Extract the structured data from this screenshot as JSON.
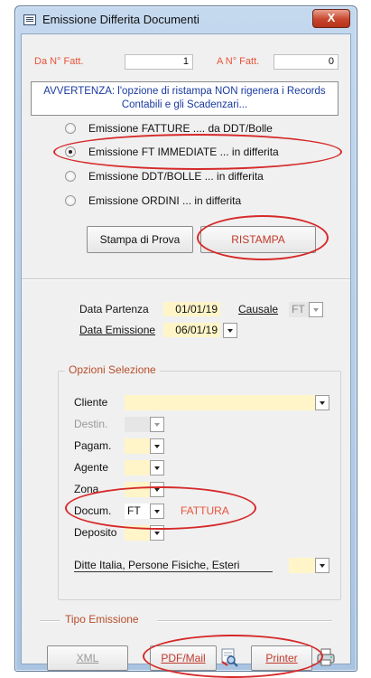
{
  "window": {
    "title": "Emissione Differita Documenti",
    "close_label": "X"
  },
  "top": {
    "from_label": "Da N° Fatt.",
    "from_value": "1",
    "to_label": "A N° Fatt.",
    "to_value": "0",
    "warning": "AVVERTENZA: l'opzione di ristampa NON rigenera i Records Contabili e gli Scadenzari..."
  },
  "options": [
    {
      "label": "Emissione FATTURE ....  da DDT/Bolle",
      "selected": false
    },
    {
      "label": "Emissione FT IMMEDIATE ... in differita",
      "selected": true
    },
    {
      "label": "Emissione DDT/BOLLE ... in differita",
      "selected": false
    },
    {
      "label": "Emissione ORDINI   ...   in differita",
      "selected": false
    }
  ],
  "buttons": {
    "stampa_prova": "Stampa di Prova",
    "ristampa": "RISTAMPA"
  },
  "dates": {
    "partenza_label": "Data Partenza",
    "partenza_value": "01/01/19",
    "emissione_label": "Data Emissione",
    "emissione_value": "06/01/19",
    "causale_label": "Causale",
    "causale_value": "FT"
  },
  "selection": {
    "title": "Opzioni Selezione",
    "cliente": "Cliente",
    "destin": "Destin.",
    "pagam": "Pagam.",
    "agente": "Agente",
    "zona": "Zona",
    "docum": "Docum.",
    "docum_value": "FT",
    "docum_desc": "FATTURA",
    "deposito": "Deposito",
    "ditte": "Ditte Italia,  Persone Fisiche,  Esteri"
  },
  "emission": {
    "title": "Tipo Emissione",
    "xml": "XML",
    "pdf_mail": "PDF/Mail",
    "printer": "Printer"
  },
  "colors": {
    "highlight_red": "#d62a2a",
    "field_yellow": "#fff5c8",
    "label_red": "#e8543a"
  }
}
